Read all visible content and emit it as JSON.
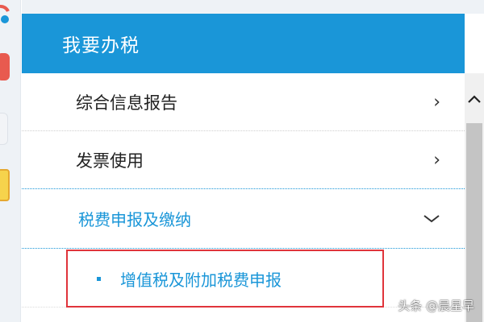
{
  "menu": {
    "header_title": "我要办税",
    "items": [
      {
        "label": "综合信息报告",
        "chevron": "›"
      },
      {
        "label": "发票使用",
        "chevron": "›"
      },
      {
        "label": "税费申报及缴纳",
        "expanded": true
      }
    ],
    "sub_items": [
      {
        "label": "增值税及附加税费申报",
        "highlighted": true
      }
    ]
  },
  "watermark": "头条 @晨星早",
  "colors": {
    "header_bg": "#1a96d8",
    "accent": "#1a96d8",
    "highlight_border": "#e0343b"
  },
  "icons": {
    "expand": "chevron-right-icon",
    "collapse": "chevron-down-icon",
    "scroll_up": "chevron-up-icon",
    "bullet": "square-bullet-icon"
  }
}
